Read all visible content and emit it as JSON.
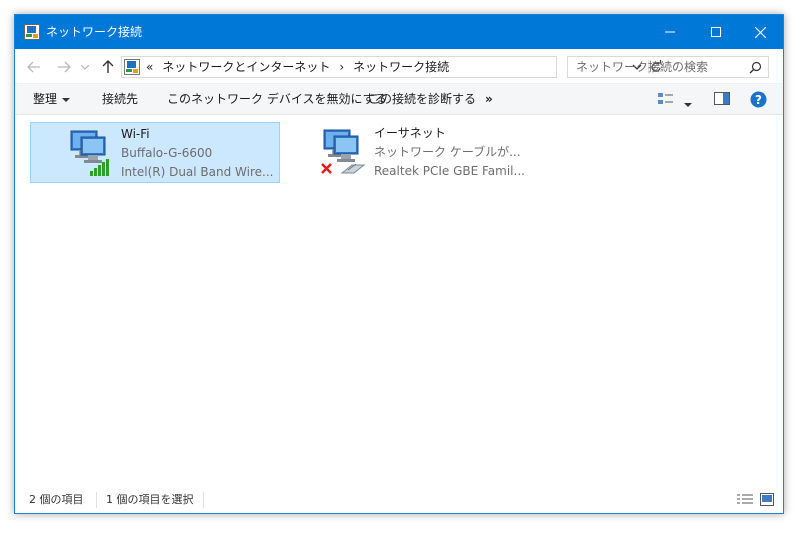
{
  "window": {
    "title": "ネットワーク接続",
    "controls": {
      "minimize": "minimize",
      "maximize": "maximize",
      "close": "close"
    }
  },
  "address": {
    "overflow": "«",
    "crumbs": [
      "ネットワークとインターネット",
      "›",
      "ネットワーク接続"
    ]
  },
  "search": {
    "placeholder": "ネットワーク接続の検索"
  },
  "commands": {
    "organize": "整理",
    "connect_to": "接続先",
    "disable_device": "このネットワーク デバイスを無効にする",
    "diagnose": "この接続を診断する",
    "more": "»"
  },
  "connections": [
    {
      "name": "Wi-Fi",
      "status": "Buffalo-G-6600",
      "device": "Intel(R) Dual Band Wire...",
      "selected": true,
      "icon": "wifi-adapter-icon"
    },
    {
      "name": "イーサネット",
      "status": "ネットワーク ケーブルが...",
      "device": "Realtek PCIe GBE Famil...",
      "selected": false,
      "icon": "ethernet-adapter-icon"
    }
  ],
  "statusbar": {
    "count": "2 個の項目",
    "selection": "1 個の項目を選択"
  },
  "colors": {
    "titlebar": "#0078d7",
    "selection": "#cce8ff",
    "help": "#1a73c9"
  }
}
